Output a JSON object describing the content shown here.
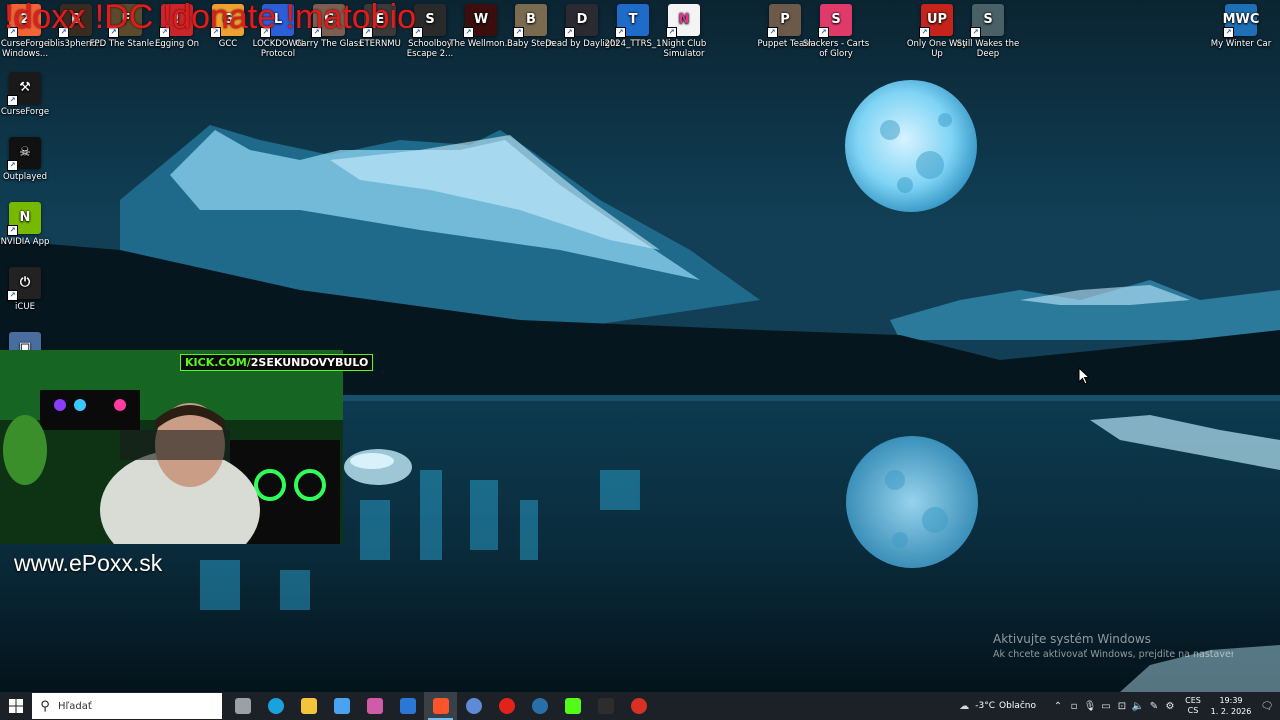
{
  "overlay": {
    "text": "!doxx !DC !donate !matobio"
  },
  "desktop": {
    "top_icons": [
      {
        "label": "CurseForge Windows...",
        "color": "#f16436",
        "glyph": "2"
      },
      {
        "label": "iblis3pheno...",
        "color": "#3a2b20",
        "glyph": "B"
      },
      {
        "label": "FPD The Stanle...",
        "color": "#5b4a2c",
        "glyph": "F"
      },
      {
        "label": "Egging On",
        "color": "#c9262c",
        "glyph": "!"
      },
      {
        "label": "GCC",
        "color": "#f0a030",
        "glyph": "G"
      },
      {
        "label": "LOCKDOWN Protocol",
        "color": "#2c5ed8",
        "glyph": "L"
      },
      {
        "label": "Carry The Glass",
        "color": "#7c5f50",
        "glyph": "C"
      },
      {
        "label": "ETERNMU",
        "color": "#3a3a3a",
        "glyph": "E"
      },
      {
        "label": "Schoolboy Escape 2...",
        "color": "#2a2a2a",
        "glyph": "S"
      },
      {
        "label": "The Wellmon...",
        "color": "#3b0d0d",
        "glyph": "W"
      },
      {
        "label": "Baby Steps",
        "color": "#7a6a50",
        "glyph": "B"
      },
      {
        "label": "Dead by Daylight",
        "color": "#2a2a30",
        "glyph": "D"
      },
      {
        "label": "2024_TTRS_1",
        "color": "#1e6bc9",
        "glyph": "T"
      },
      {
        "label": "Night Club Simulator",
        "color": "#f4f4f4",
        "glyph": "N"
      },
      {
        "label": "Puppet Team",
        "color": "#6b5a4a",
        "glyph": "P"
      },
      {
        "label": "Slackers - Carts of Glory",
        "color": "#e03a6a",
        "glyph": "S"
      },
      {
        "label": "Only One Way Up",
        "color": "#c4241c",
        "glyph": "UP"
      },
      {
        "label": "Still Wakes the Deep",
        "color": "#486066",
        "glyph": "S"
      },
      {
        "label": "My Winter Car",
        "color": "#1f6fb6",
        "glyph": "MWC"
      }
    ],
    "left_icons": [
      {
        "label": "CurseForge",
        "color": "#1a1a1a",
        "glyph": "⚒"
      },
      {
        "label": "Outplayed",
        "color": "#111111",
        "glyph": "☠"
      },
      {
        "label": "NVIDIA App",
        "color": "#76b900",
        "glyph": "N"
      },
      {
        "label": "iCUE",
        "color": "#222222",
        "glyph": "⏻"
      },
      {
        "label": "",
        "color": "#4a6da0",
        "glyph": "▣"
      }
    ]
  },
  "stream": {
    "kick_prefix": "KICK.COM/",
    "kick_name": "2SEKUNDOVYBULO",
    "site": "www.ePoxx.sk"
  },
  "activation": {
    "title": "Aktivujte systém Windows",
    "subtitle": "Ak chcete aktivovať Windows, prejdite na nastaven"
  },
  "taskbar": {
    "search_placeholder": "Hľadať",
    "apps": [
      {
        "name": "task-view",
        "color": "#9aa0a6"
      },
      {
        "name": "edge",
        "color": "#1aa2de"
      },
      {
        "name": "file-explorer",
        "color": "#f2c53d"
      },
      {
        "name": "store",
        "color": "#4aa3f0"
      },
      {
        "name": "office",
        "color": "#d05ca8"
      },
      {
        "name": "mail",
        "color": "#2b78d4"
      },
      {
        "name": "brave",
        "color": "#fb542b"
      },
      {
        "name": "app-blue",
        "color": "#5f8bd6"
      },
      {
        "name": "opera",
        "color": "#e2231a"
      },
      {
        "name": "steam",
        "color": "#2a6ea8"
      },
      {
        "name": "kick",
        "color": "#53fc18"
      },
      {
        "name": "obs",
        "color": "#2d2d2d"
      },
      {
        "name": "chrome-dev",
        "color": "#d93025"
      }
    ],
    "weather": {
      "temp": "-3°C",
      "condition": "Oblačno"
    },
    "language": {
      "top": "CES",
      "bottom": "CS"
    },
    "time": "19:39",
    "date": "1. 2. 2026"
  }
}
